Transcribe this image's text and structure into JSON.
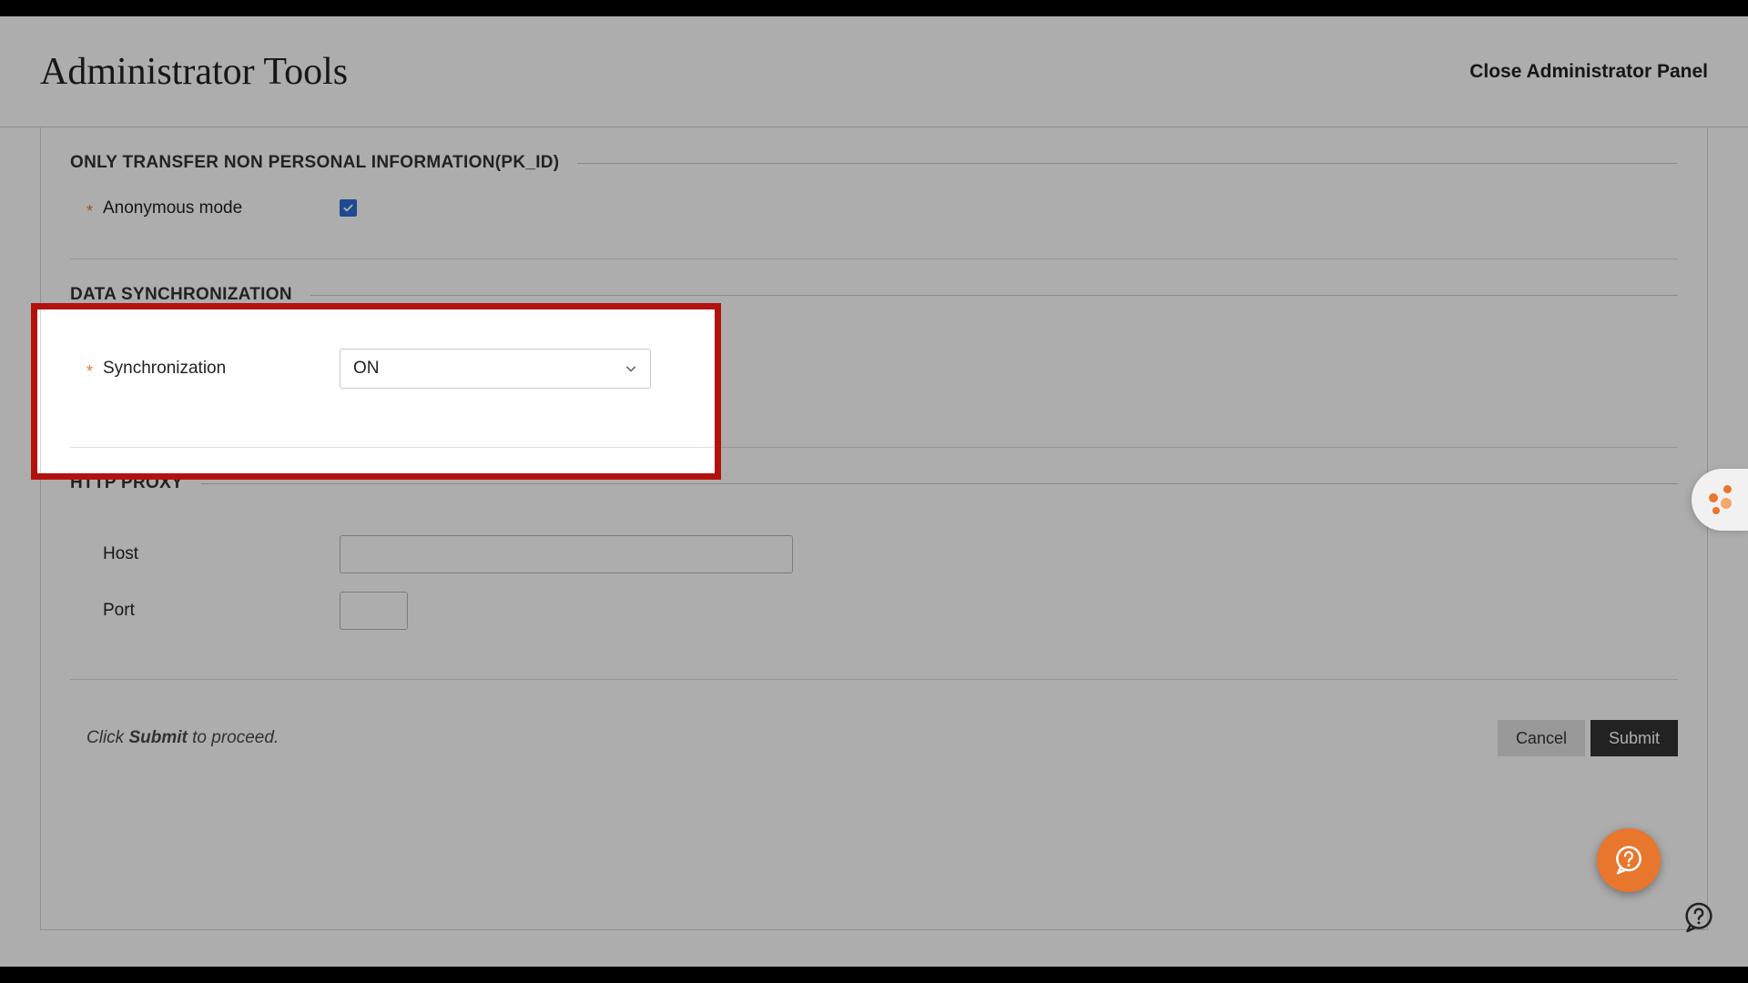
{
  "header": {
    "title": "Administrator Tools",
    "close_label": "Close Administrator Panel"
  },
  "sections": {
    "nonpersonal": {
      "heading": "ONLY TRANSFER NON PERSONAL INFORMATION(PK_ID)",
      "field_label": "Anonymous mode",
      "checked": true
    },
    "sync": {
      "heading": "DATA SYNCHRONIZATION",
      "field_label": "Synchronization",
      "value": "ON"
    },
    "proxy": {
      "heading": "HTTP PROXY",
      "host_label": "Host",
      "host_value": "",
      "port_label": "Port",
      "port_value": ""
    }
  },
  "footer": {
    "hint_prefix": "Click ",
    "hint_bold": "Submit",
    "hint_suffix": " to proceed.",
    "cancel_label": "Cancel",
    "submit_label": "Submit"
  },
  "colors": {
    "accent": "#e8762c",
    "highlight": "#b1120e",
    "checkbox": "#2b6ed9"
  }
}
